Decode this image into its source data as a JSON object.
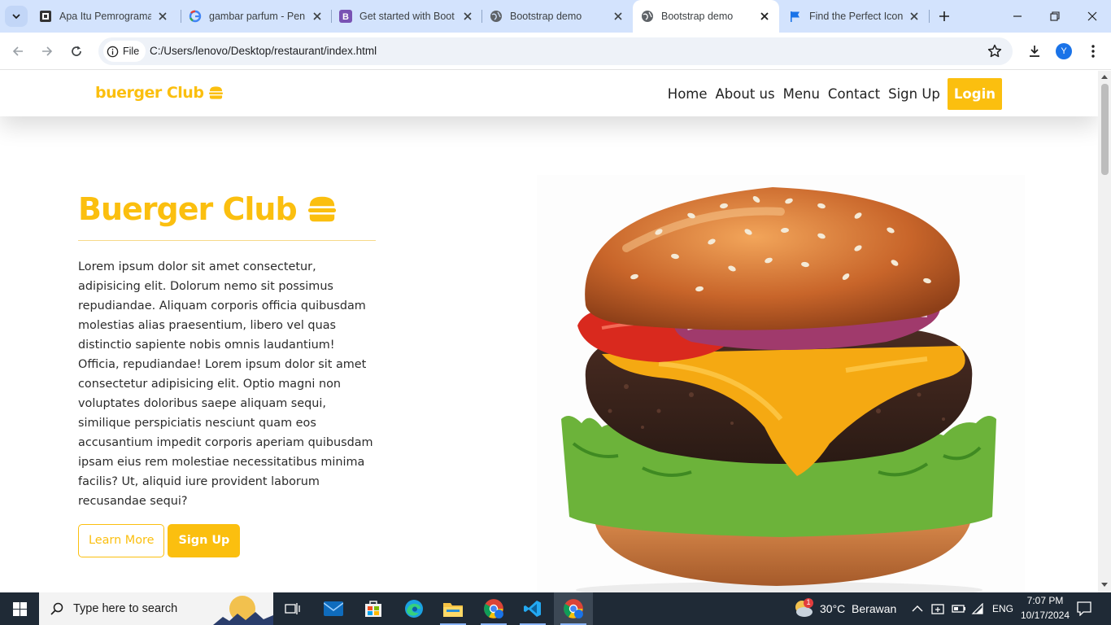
{
  "browser": {
    "tabs": [
      {
        "title": "Apa Itu Pemrograman",
        "favicon": "medium-icon"
      },
      {
        "title": "gambar parfum - Pen",
        "favicon": "google-icon"
      },
      {
        "title": "Get started with Boot",
        "favicon": "bootstrap-icon"
      },
      {
        "title": "Bootstrap demo",
        "favicon": "globe-icon"
      },
      {
        "title": "Bootstrap demo",
        "favicon": "globe-icon",
        "active": true
      },
      {
        "title": "Find the Perfect Icon",
        "favicon": "flag-icon"
      }
    ],
    "site_chip": "File",
    "url": "C:/Users/lenovo/Desktop/restaurant/index.html",
    "profile_initial": "Y"
  },
  "page": {
    "brand": "buerger Club",
    "nav": {
      "home": "Home",
      "about": "About us",
      "menu": "Menu",
      "contact": "Contact",
      "signup": "Sign Up",
      "login": "Login"
    },
    "hero": {
      "title": "Buerger Club",
      "text": "Lorem ipsum dolor sit amet consectetur, adipisicing elit. Dolorum nemo sit possimus repudiandae. Aliquam corporis officia quibusdam molestias alias praesentium, libero vel quas distinctio sapiente nobis omnis laudantium! Officia, repudiandae! Lorem ipsum dolor sit amet consectetur adipisicing elit. Optio magni non voluptates doloribus saepe aliquam sequi, similique perspiciatis nesciunt quam eos accusantium impedit corporis aperiam quibusdam ipsam eius rem molestiae necessitatibus minima facilis? Ut, aliquid iure provident laborum recusandae sequi?",
      "learn_more": "Learn More",
      "sign_up": "Sign Up"
    },
    "accent_color": "#fbbf0f"
  },
  "taskbar": {
    "search_placeholder": "Type here to search",
    "weather": "30°C  Berawan",
    "language": "ENG",
    "time": "7:07 PM",
    "date": "10/17/2024",
    "weather_badge": "1"
  }
}
